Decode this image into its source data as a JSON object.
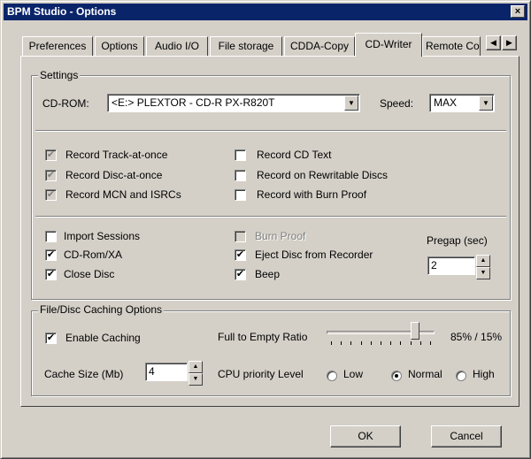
{
  "window": {
    "title": "BPM Studio - Options",
    "close_glyph": "×"
  },
  "tabs": [
    {
      "label": "Preferences"
    },
    {
      "label": "Options"
    },
    {
      "label": "Audio I/O"
    },
    {
      "label": "File storage"
    },
    {
      "label": "CDDA-Copy"
    },
    {
      "label": "CD-Writer",
      "active": true
    },
    {
      "label": "Remote Co"
    }
  ],
  "tab_scroll": {
    "left": "◀",
    "right": "▶"
  },
  "settings": {
    "group_label": "Settings",
    "cdrom_label": "CD-ROM:",
    "cdrom_value": "<E:> PLEXTOR - CD-R   PX-R820T",
    "speed_label": "Speed:",
    "speed_value": "MAX",
    "drop_glyph": "▼",
    "record_options": [
      {
        "label": "Record Track-at-once",
        "checked": true,
        "greyed": true
      },
      {
        "label": "Record Disc-at-once",
        "checked": true,
        "greyed": true
      },
      {
        "label": "Record MCN and ISRCs",
        "checked": true,
        "greyed": true
      },
      {
        "label": "Record CD Text",
        "checked": false
      },
      {
        "label": "Record on Rewritable Discs",
        "checked": false
      },
      {
        "label": "Record with Burn Proof",
        "checked": false
      }
    ],
    "misc_options": [
      {
        "label": "Import Sessions",
        "checked": false
      },
      {
        "label": "CD-Rom/XA",
        "checked": true
      },
      {
        "label": "Close Disc",
        "checked": true
      },
      {
        "label": "Burn Proof",
        "checked": false,
        "disabled": true
      },
      {
        "label": "Eject Disc from Recorder",
        "checked": true
      },
      {
        "label": "Beep",
        "checked": true
      }
    ],
    "pregap_label": "Pregap (sec)",
    "pregap_value": "2"
  },
  "caching": {
    "group_label": "File/Disc Caching Options",
    "enable_label": "Enable Caching",
    "enable_checked": true,
    "ratio_label": "Full to Empty Ratio",
    "ratio_value": "85% / 15%",
    "ratio_fraction": 0.85,
    "cache_size_label": "Cache Size (Mb)",
    "cache_size_value": "4",
    "cpu_label": "CPU priority Level",
    "cpu_options": [
      {
        "label": "Low",
        "selected": false
      },
      {
        "label": "Normal",
        "selected": true
      },
      {
        "label": "High",
        "selected": false
      }
    ]
  },
  "buttons": {
    "ok": "OK",
    "cancel": "Cancel"
  },
  "glyphs": {
    "check": "✔",
    "spin_up": "▲",
    "spin_down": "▼"
  }
}
